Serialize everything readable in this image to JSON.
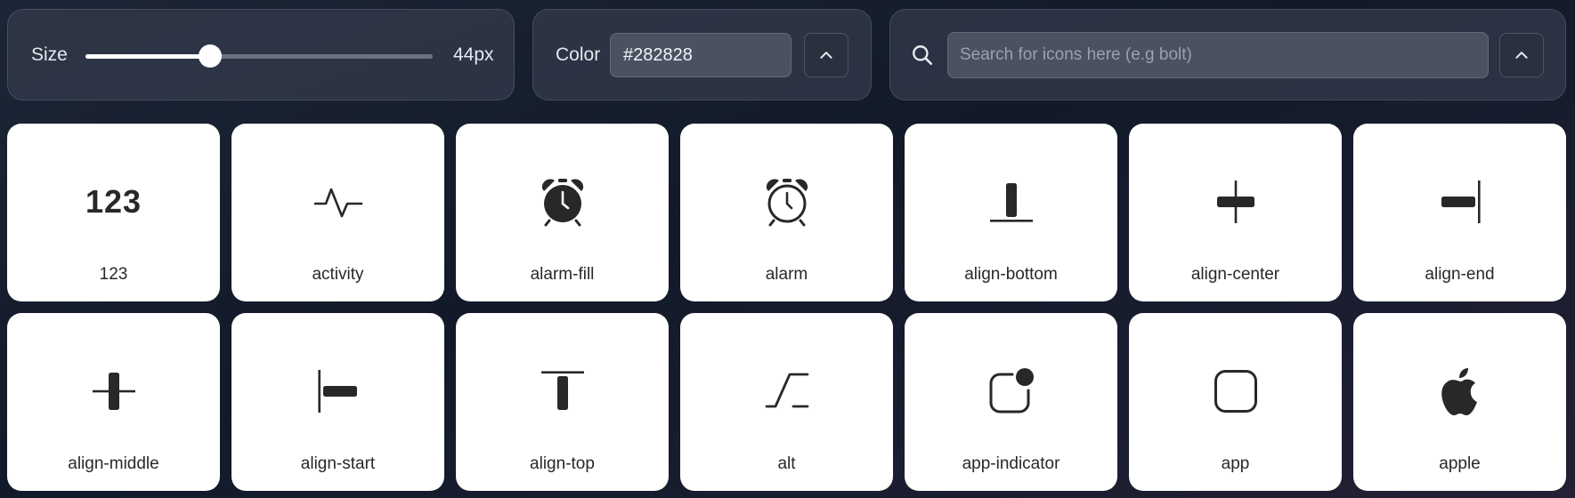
{
  "size_control": {
    "label": "Size",
    "value_text": "44px",
    "slider_fraction": 0.36
  },
  "color_control": {
    "label": "Color",
    "value": "#282828"
  },
  "search": {
    "placeholder": "Search for icons here (e.g bolt)",
    "value": ""
  },
  "colors": {
    "icon": "#282828",
    "card": "#ffffff",
    "panel": "#343c4c"
  },
  "icons": [
    {
      "name": "123",
      "glyph_text": "123"
    },
    {
      "name": "activity"
    },
    {
      "name": "alarm-fill"
    },
    {
      "name": "alarm"
    },
    {
      "name": "align-bottom"
    },
    {
      "name": "align-center"
    },
    {
      "name": "align-end"
    },
    {
      "name": "align-middle"
    },
    {
      "name": "align-start"
    },
    {
      "name": "align-top"
    },
    {
      "name": "alt"
    },
    {
      "name": "app-indicator"
    },
    {
      "name": "app"
    },
    {
      "name": "apple"
    }
  ]
}
